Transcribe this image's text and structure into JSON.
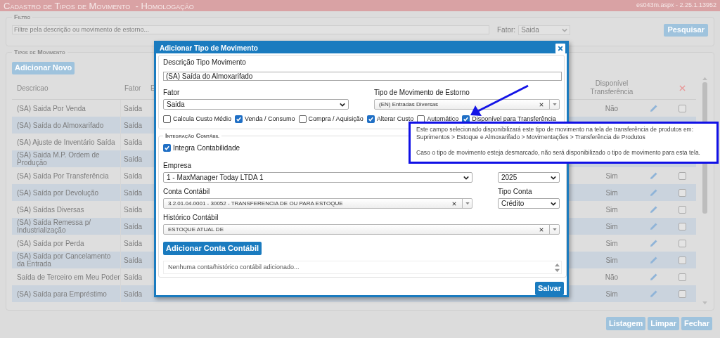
{
  "app_header": {
    "title": "Cadastro de Tipos de Movimento  - Homologação",
    "page_info": "es043m.aspx - 2.25.1.13952"
  },
  "filter": {
    "legend": "Filtro",
    "search": {
      "placeholder": "Filtre pela descrição ou movimento de estorno..."
    },
    "fator_label": "Fator:",
    "fator_value": "Saida",
    "search_button": "Pesquisar"
  },
  "movement_types": {
    "legend": "Tipos de Movimento",
    "add_button": "Adicionar Novo",
    "columns": [
      "Descricao",
      "Fator",
      "E",
      "Disponível Transferência"
    ],
    "rows": [
      {
        "descricao": "(SA) Saida Por Venda",
        "fator": "Saída",
        "disponivel": "Não",
        "checked": false
      },
      {
        "descricao": "(SA) Saída do Almoxarifado",
        "fator": "Saída"
      },
      {
        "descricao": "(SA) Ajuste de Inventário Saída",
        "fator": "Saída"
      },
      {
        "descricao": "(SA) Saida M.P. Ordem de Produção",
        "fator": "Saída"
      },
      {
        "descricao": "(SA) Saída Por Transferência",
        "fator": "Saída",
        "disponivel": "Sim",
        "checked": false
      },
      {
        "descricao": "(SA) Saída por Devolução",
        "fator": "Saída",
        "disponivel": "Sim",
        "checked": false
      },
      {
        "descricao": "(SA) Saídas Diversas",
        "fator": "Saída",
        "disponivel": "Sim",
        "checked": false
      },
      {
        "descricao": "(SA) Saída Remessa p/ Industrialização",
        "fator": "Saída",
        "disponivel": "Sim",
        "checked": false
      },
      {
        "descricao": "(SA) Saída por Perda",
        "fator": "Saída",
        "disponivel": "Sim",
        "checked": false
      },
      {
        "descricao": "(SA) Saída por Cancelamento da Entrada",
        "fator": "Saída",
        "disponivel": "Sim",
        "checked": false
      },
      {
        "descricao": "Saída de Terceiro em Meu Poder",
        "fator": "Saída",
        "disponivel": "Não",
        "checked": false
      },
      {
        "descricao": "(SA) Saída para Empréstimo",
        "fator": "Saída",
        "disponivel": "Sim",
        "checked": false
      }
    ]
  },
  "bottom_buttons": [
    "Listagem",
    "Limpar",
    "Fechar"
  ],
  "dialog": {
    "title": "Adicionar Tipo de Movimento",
    "description": {
      "label": "Descrição Tipo Movimento",
      "value": "(SA) Saída do Almoxarifado"
    },
    "fator": {
      "label": "Fator",
      "value": "Saida"
    },
    "estorno": {
      "label": "Tipo de Movimento de Estorno",
      "value": "(EN) Entradas Diversas"
    },
    "options": [
      {
        "label": "Calcula Custo Médio",
        "checked": false
      },
      {
        "label": "Venda / Consumo",
        "checked": true
      },
      {
        "label": "Compra / Aquisição",
        "checked": false
      },
      {
        "label": "Alterar Custo",
        "checked": true
      },
      {
        "label": "Automático",
        "checked": false
      },
      {
        "label": "Disponível para Transferência",
        "checked": true
      }
    ],
    "integration": {
      "legend": "Integração Contábil",
      "integra": {
        "label": "Integra Contabilidade",
        "checked": true
      },
      "empresa": {
        "label": "Empresa",
        "value": "1 - MaxManager Today LTDA 1"
      },
      "ano": {
        "value": "2025"
      },
      "conta": {
        "label": "Conta Contábil",
        "value": "3.2.01.04.0001 - 30052 - TRANSFERENCIA DE OU PARA ESTOQUE"
      },
      "tipo_conta": {
        "label": "Tipo Conta",
        "value": "Crédito"
      },
      "historico": {
        "label": "Histórico Contábil",
        "value": "ESTOQUE ATUAL DE"
      },
      "add_button": "Adicionar Conta Contábil",
      "list_empty": "Nenhuma conta/histórico contábil adicionado..."
    },
    "save_button": "Salvar"
  },
  "tooltip": {
    "paragraphs": [
      [
        "Este campo selecionado disponibilizará este tipo de movimento na tela de transferência de produtos em:",
        "Suprimentos > Estoque e Almoxarifado > Movimentações > Transferência de Produtos"
      ],
      [
        "Caso o tipo de movimento esteja desmarcado, não será disponibilizado o tipo de movimento para esta tela."
      ]
    ]
  }
}
